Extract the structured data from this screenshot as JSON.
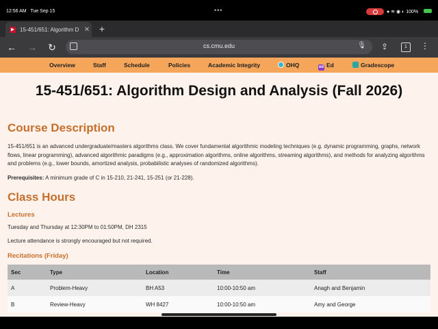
{
  "status": {
    "time": "12:56 AM",
    "date": "Tue Sep 15",
    "battery": "100%"
  },
  "browser": {
    "tab_title": "15-451/651: Algorithm D",
    "url": "cs.cmu.edu",
    "tab_count": "1"
  },
  "nav": {
    "items": [
      "Overview",
      "Staff",
      "Schedule",
      "Policies",
      "Academic Integrity",
      "OHQ",
      "Ed",
      "Gradescope"
    ],
    "ed_icon_text": "ed"
  },
  "page": {
    "title": "15-451/651: Algorithm Design and Analysis (Fall 2026)",
    "course_description_heading": "Course Description",
    "course_description": "15-451/651 is an advanced undergraduate/masters algorithms class. We cover fundamental algorithmic modeling techniques (e.g. dynamic programming, graphs, network flows, linear programming), advanced algorithmic paradigms (e.g., approximation algorithms, online algorithms, streaming algorithms), and methods for analyzing algorithms and problems (e.g., lower bounds, amortized analysis, probabilistic analyses of randomized algorithms).",
    "prereq_label": "Prerequisites:",
    "prereq_text": " A minimum grade of C in 15-210, 21-241, 15-251 (or 21-228).",
    "class_hours_heading": "Class Hours",
    "lectures_heading": "Lectures",
    "lectures_time": "Tuesday and Thursday at 12:30PM to 01:50PM, DH 2315",
    "lectures_note": "Lecture attendance is strongly encouraged but not required.",
    "recitations_heading": "Recitations (Friday)",
    "recitations_table": {
      "headers": [
        "Sec",
        "Type",
        "Location",
        "Time",
        "Staff"
      ],
      "rows": [
        [
          "A",
          "Problem-Heavy",
          "BH A53",
          "10:00-10:50 am",
          "Anagh and Benjamin"
        ],
        [
          "B",
          "Review-Heavy",
          "WH 8427",
          "10:00-10:50 am",
          "Amy and George"
        ]
      ]
    }
  },
  "colors": {
    "nav_bg": "#f5a65b",
    "heading": "#c66f2a",
    "page_bg": "#fdf2ec"
  }
}
